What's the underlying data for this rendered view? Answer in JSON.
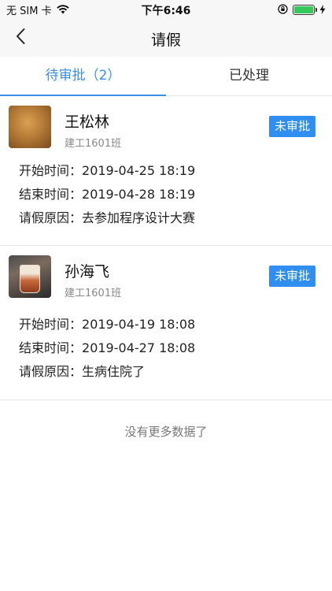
{
  "status_bar": {
    "carrier": "无 SIM 卡",
    "time": "下午6:46",
    "battery_level": 1.0,
    "icons": [
      "wifi-icon",
      "orientation-lock-icon",
      "battery-icon",
      "charging-icon"
    ]
  },
  "nav": {
    "title": "请假",
    "back_icon": "chevron-left-icon"
  },
  "tabs": [
    {
      "label": "待审批（2）",
      "active": true
    },
    {
      "label": "已处理",
      "active": false
    }
  ],
  "requests": [
    {
      "name": "王松林",
      "dept": "建工1601班",
      "status": "未审批",
      "start_label": "开始时间：",
      "start_value": "2019-04-25 18:19",
      "end_label": "结束时间：",
      "end_value": "2019-04-28 18:19",
      "reason_label": "请假原因：",
      "reason_value": "去参加程序设计大赛"
    },
    {
      "name": "孙海飞",
      "dept": "建工1601班",
      "status": "未审批",
      "start_label": "开始时间：",
      "start_value": "2019-04-19 18:08",
      "end_label": "结束时间：",
      "end_value": "2019-04-27 18:08",
      "reason_label": "请假原因：",
      "reason_value": "生病住院了"
    }
  ],
  "footer_text": "没有更多数据了",
  "colors": {
    "accent": "#3a8ee6",
    "badge": "#2f8ef0",
    "battery": "#35c759"
  }
}
